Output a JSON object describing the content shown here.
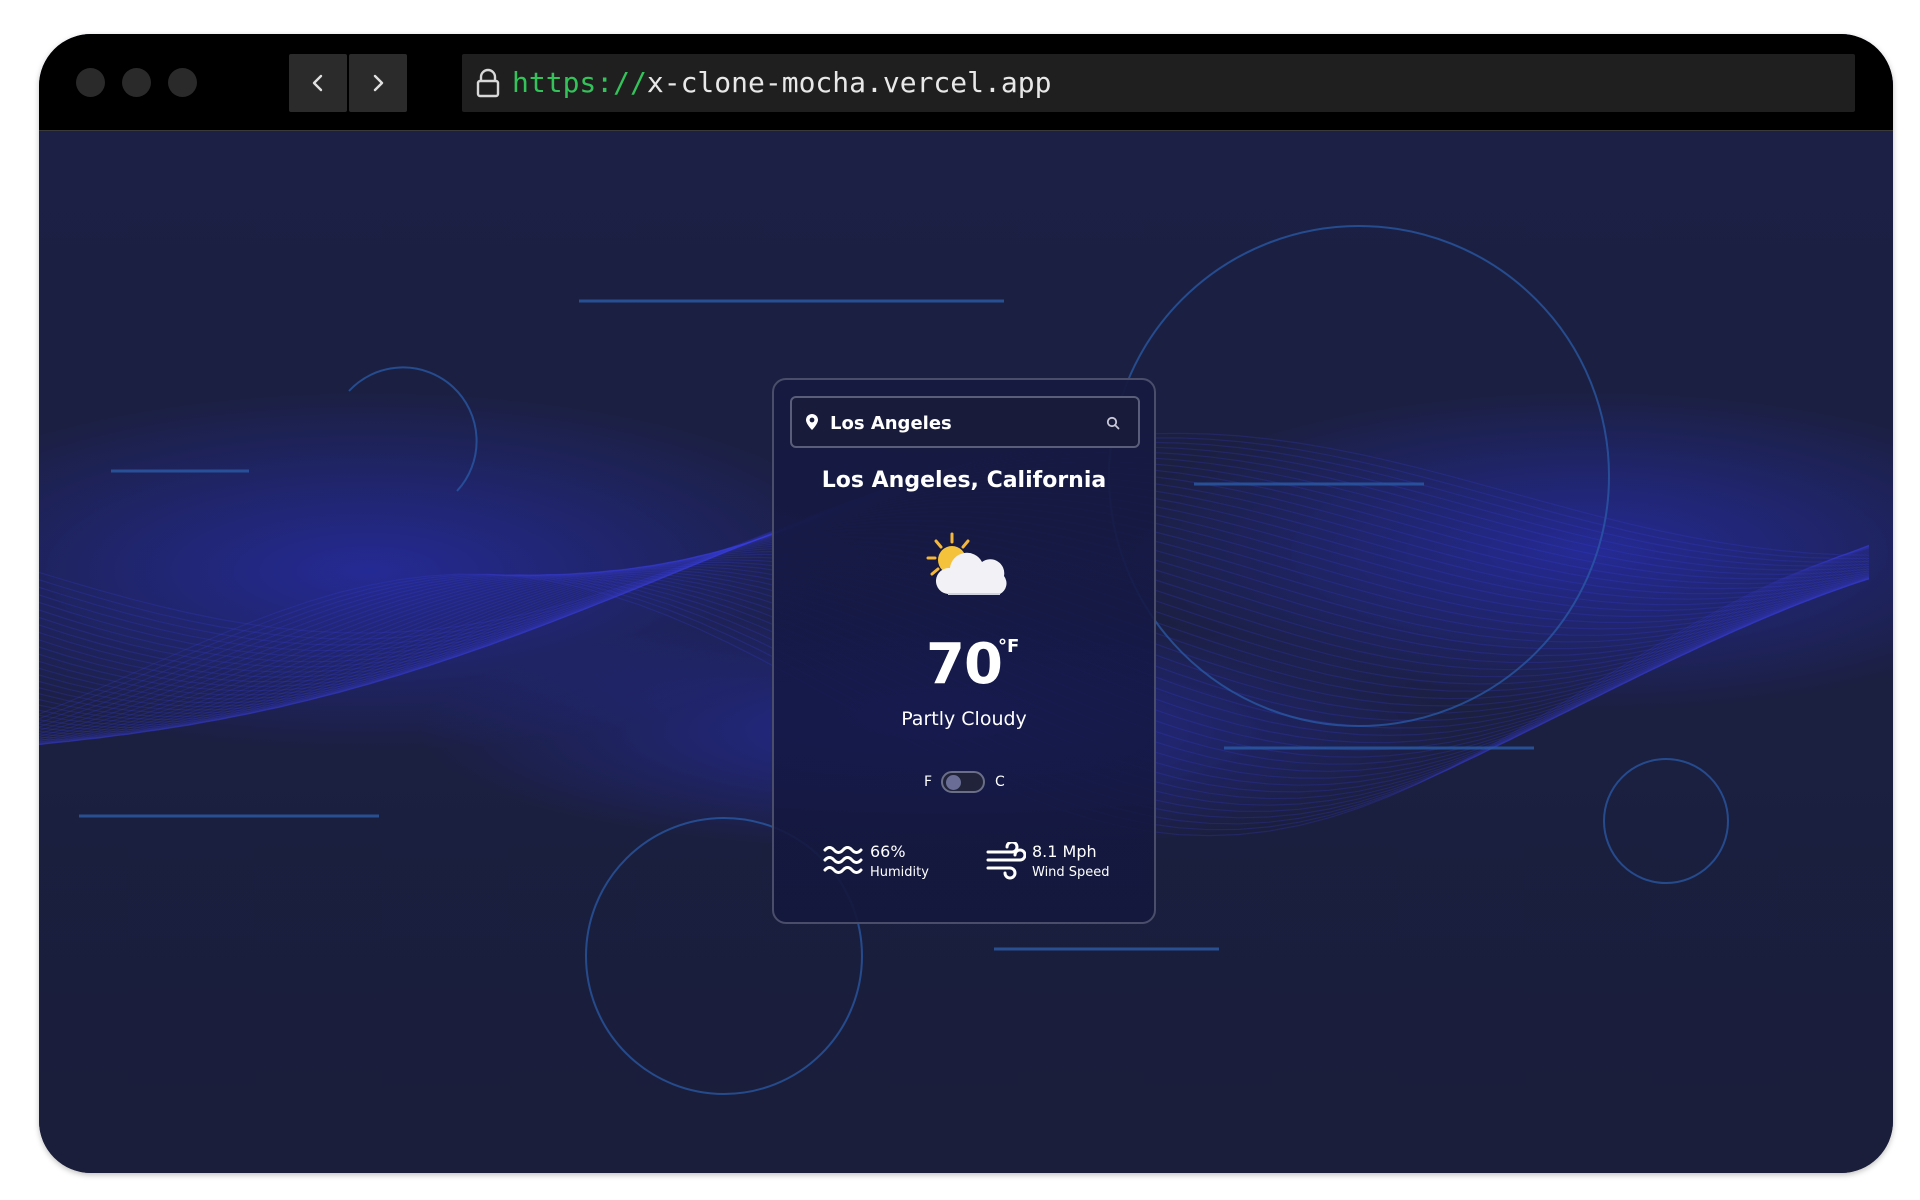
{
  "browser": {
    "url_scheme": "https://",
    "url_host": "x-clone-mocha.vercel.app"
  },
  "weather": {
    "search_value": "Los Angeles",
    "location": "Los Angeles, California",
    "icon": "partly-cloudy-icon",
    "temperature": "70",
    "unit": "°F",
    "condition": "Partly Cloudy",
    "toggle": {
      "left_label": "F",
      "right_label": "C",
      "selected": "F"
    },
    "humidity": {
      "value": "66%",
      "label": "Humidity"
    },
    "wind": {
      "value": "8.1 Mph",
      "label": "Wind Speed"
    }
  },
  "colors": {
    "page_background": "#1b2044",
    "wave_accent": "#2a30c8",
    "url_scheme_green": "#34c35a",
    "sun_yellow": "#f5c33b"
  }
}
